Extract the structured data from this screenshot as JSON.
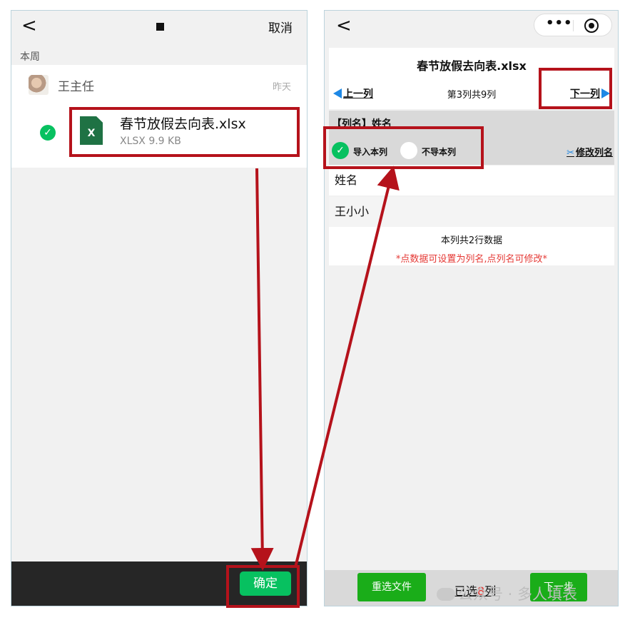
{
  "left": {
    "nav": {
      "back": "<",
      "cancel": "取消"
    },
    "section": "本周",
    "chat": {
      "sender": "王主任",
      "time": "昨天",
      "file_icon_letter": "X",
      "file_name": "春节放假去向表.xlsx",
      "file_meta": "XLSX 9.9 KB"
    },
    "confirm": "确定"
  },
  "right": {
    "nav": {
      "back": "<",
      "more": "•••"
    },
    "file_title": "春节放假去向表.xlsx",
    "prev": "上一列",
    "col_info": "第3列共9列",
    "next": "下一列",
    "col_label_prefix": "【列名】",
    "col_label_name": "姓名",
    "import_label": "导入本列",
    "skip_label": "不导本列",
    "rename": "修改列名",
    "rows": [
      "姓名",
      "王小小"
    ],
    "row_count": "本列共2行数据",
    "hint": "*点数据可设置为列名,点列名可修改*",
    "reselect": "重选文件",
    "selected_prefix": "已选",
    "selected_count": "8",
    "selected_suffix": "列",
    "next_step": "下一步"
  },
  "watermark": "公众号 · 多人填表",
  "colors": {
    "accent_green": "#07c160",
    "annotation_red": "#b5121b",
    "link_blue": "#1e88e5",
    "hint_red": "#e53935"
  }
}
